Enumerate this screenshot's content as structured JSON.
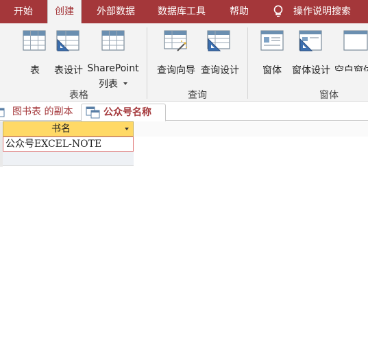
{
  "menu": {
    "tabs": [
      "开始",
      "创建",
      "外部数据",
      "数据库工具",
      "帮助"
    ],
    "active_tab": "创建",
    "tell_me": "操作说明搜索"
  },
  "ribbon": {
    "tables": {
      "table": "表",
      "table_design": "表设计",
      "sharepoint_line1": "SharePoint",
      "sharepoint_line2": "列表",
      "group_label": "表格"
    },
    "queries": {
      "query_wizard": "查询向导",
      "query_design": "查询设计",
      "group_label": "查询"
    },
    "forms": {
      "form": "窗体",
      "form_design": "窗体设计",
      "blank_form": "空白窗体",
      "group_label": "窗体"
    }
  },
  "doc_tabs": {
    "inactive": "图书表 的副本",
    "active": "公众号名称"
  },
  "datasheet": {
    "column_header": "书名",
    "cell_value": "公众号EXCEL-NOTE"
  },
  "colors": {
    "accent": "#a4373a",
    "header_fill": "#ffd966",
    "ribbon_bg": "#f3f3f3"
  }
}
